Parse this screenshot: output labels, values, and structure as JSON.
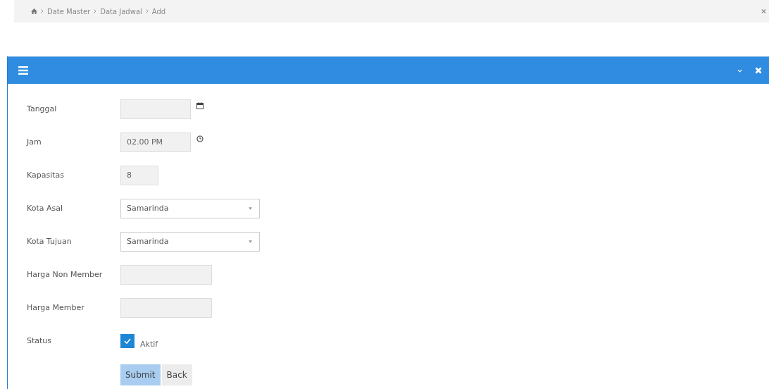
{
  "breadcrumb": [
    "Date Master",
    "Data Jadwal",
    "Add"
  ],
  "form": {
    "fields": [
      {
        "label": "Tanggal",
        "kind": "date"
      },
      {
        "label": "Jam",
        "kind": "time",
        "value": "02.00 PM"
      },
      {
        "label": "Kapasitas",
        "kind": "number",
        "value": "8"
      },
      {
        "label": "Kota Asal",
        "kind": "select",
        "value": "Samarinda"
      },
      {
        "label": "Kota Tujuan",
        "kind": "select",
        "value": "Samarinda"
      },
      {
        "label": "Harga Non Member",
        "kind": "text"
      },
      {
        "label": "Harga Member",
        "kind": "text"
      },
      {
        "label": "Status",
        "kind": "checkbox",
        "option": "Aktif",
        "checked": true
      }
    ],
    "buttons": [
      {
        "label": "Submit",
        "kind": "primary"
      },
      {
        "label": "Back",
        "kind": "default"
      }
    ]
  }
}
